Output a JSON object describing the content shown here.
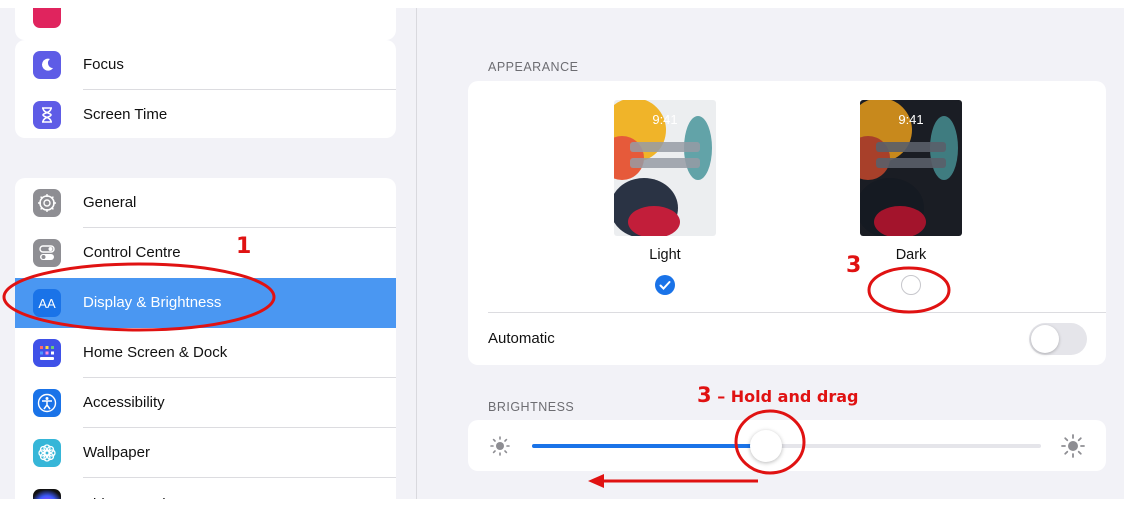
{
  "sidebar": {
    "items_top": [
      {
        "label": "Focus",
        "icon": "moon-icon",
        "color": "#5e5ce6"
      },
      {
        "label": "Screen Time",
        "icon": "hourglass-icon",
        "color": "#5e5ce6"
      }
    ],
    "items": [
      {
        "label": "General",
        "icon": "gear-icon",
        "color": "#8e8e93"
      },
      {
        "label": "Control Centre",
        "icon": "toggles-icon",
        "color": "#8e8e93"
      },
      {
        "label": "Display & Brightness",
        "icon": "aa-icon",
        "glyph": "AA",
        "color": "#1a73e8",
        "selected": true
      },
      {
        "label": "Home Screen & Dock",
        "icon": "grid-icon",
        "color": "#3f51e8"
      },
      {
        "label": "Accessibility",
        "icon": "accessibility-icon",
        "color": "#1a73e8"
      },
      {
        "label": "Wallpaper",
        "icon": "flower-icon",
        "color": "#36b6d8"
      },
      {
        "label": "Siri & Search",
        "icon": "siri-icon",
        "color": "#222222"
      }
    ]
  },
  "appearance": {
    "header": "APPEARANCE",
    "time": "9:41",
    "light_label": "Light",
    "dark_label": "Dark",
    "selected": "Light",
    "automatic_label": "Automatic",
    "automatic_on": false
  },
  "brightness": {
    "header": "BRIGHTNESS",
    "level": 0.46
  },
  "annotations": {
    "step1": "1",
    "step3": "3",
    "drag_num": "3",
    "drag_text": " – Hold and drag"
  },
  "colors": {
    "accent": "#1a73e8",
    "selection": "#4a97f2",
    "annotation": "#e01212"
  }
}
